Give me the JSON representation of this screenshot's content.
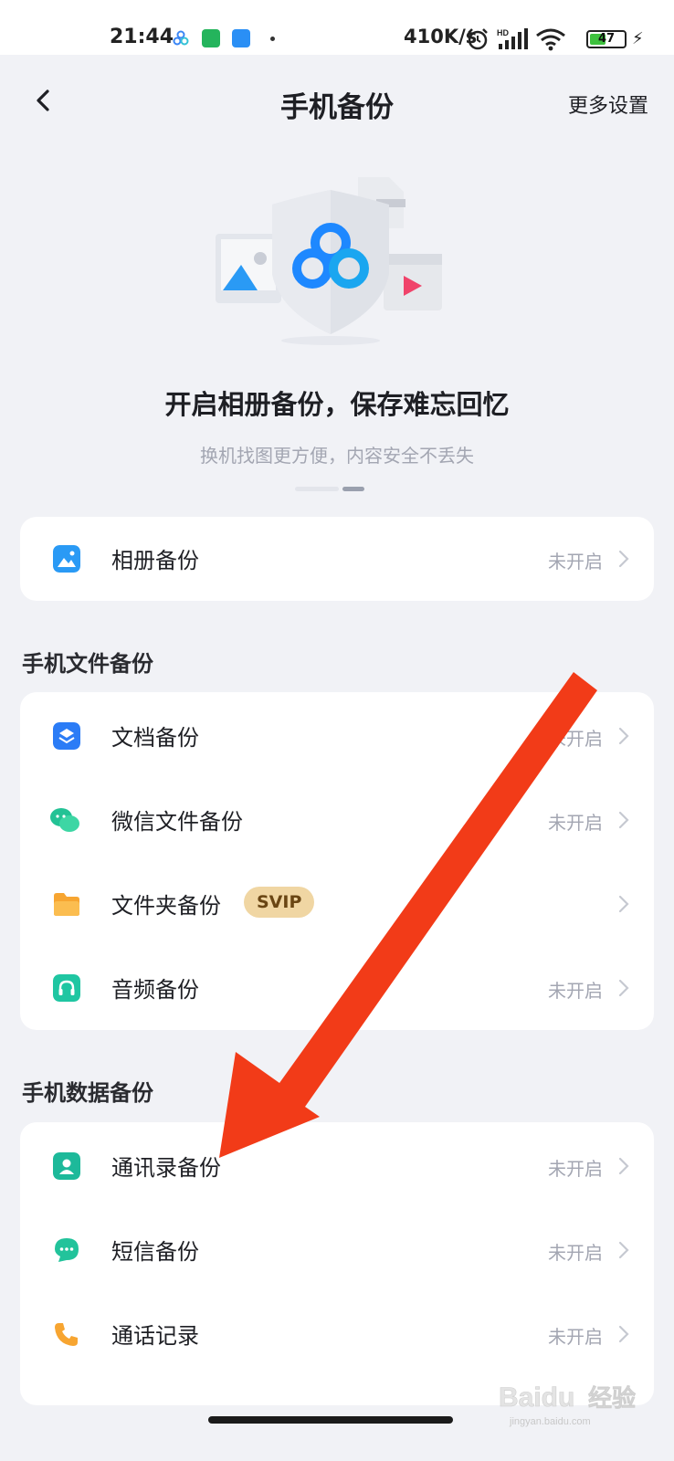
{
  "status_bar": {
    "time": "21:44",
    "net_speed": "410K/s",
    "battery_level": 47,
    "battery_text": "47",
    "hd_label": "HD"
  },
  "header": {
    "title": "手机备份",
    "more_label": "更多设置"
  },
  "hero": {
    "title": "开启相册备份，保存难忘回忆",
    "subtitle": "换机找图更方便，内容安全不丢失"
  },
  "album_card": {
    "label": "相册备份",
    "status": "未开启"
  },
  "file_section": {
    "title": "手机文件备份",
    "items": [
      {
        "label": "文档备份",
        "status": "未开启",
        "icon": "document-icon"
      },
      {
        "label": "微信文件备份",
        "status": "未开启",
        "icon": "wechat-icon"
      },
      {
        "label": "文件夹备份",
        "badge": "SVIP",
        "status": "",
        "icon": "folder-icon"
      },
      {
        "label": "音频备份",
        "status": "未开启",
        "icon": "audio-icon"
      }
    ]
  },
  "data_section": {
    "title": "手机数据备份",
    "items": [
      {
        "label": "通讯录备份",
        "status": "未开启",
        "icon": "contacts-icon"
      },
      {
        "label": "短信备份",
        "status": "未开启",
        "icon": "sms-icon"
      },
      {
        "label": "通话记录",
        "status": "未开启",
        "icon": "phone-icon"
      }
    ]
  },
  "watermark": {
    "brand": "Baidu",
    "text": "经验",
    "url": "jingyan.baidu.com"
  },
  "colors": {
    "background": "#f1f2f6",
    "card": "#ffffff",
    "brand_blue": "#1e88ff",
    "svip_gold": "#f0d6a3",
    "arrow_red": "#f23b18",
    "muted_text": "#a3a6b2"
  }
}
